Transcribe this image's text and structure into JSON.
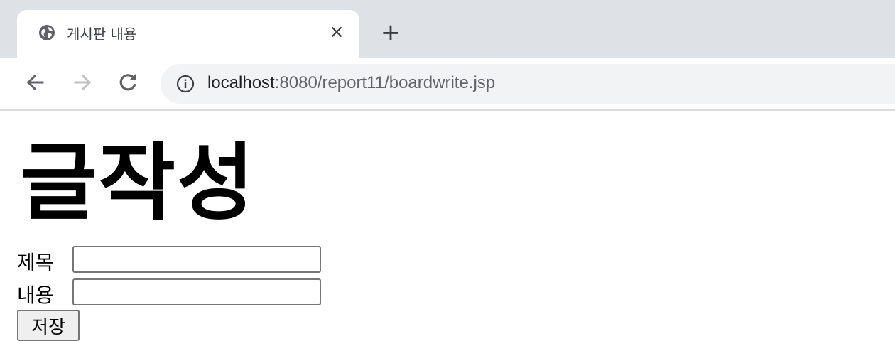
{
  "browser": {
    "tab": {
      "title": "게시판 내용",
      "close_glyph": "×",
      "favicon": "globe-icon"
    },
    "new_tab_glyph": "+",
    "nav": {
      "back_icon": "arrow-left-icon",
      "forward_icon": "arrow-right-icon",
      "reload_icon": "reload-icon"
    },
    "omnibox": {
      "info_icon": "info-icon",
      "url_host": "localhost",
      "url_path": ":8080/report11/boardwrite.jsp"
    }
  },
  "page": {
    "heading": "글작성",
    "form": {
      "title_label": "제목",
      "title_value": "",
      "body_label": "내용",
      "body_value": "",
      "submit_label": "저장"
    }
  },
  "colors": {
    "tabstrip": "#dee1e6",
    "omnibox": "#f1f3f4",
    "chrome_text": "#3c4043",
    "url_path": "#5f6368",
    "button_bg": "#efefef",
    "input_border": "#767676"
  }
}
